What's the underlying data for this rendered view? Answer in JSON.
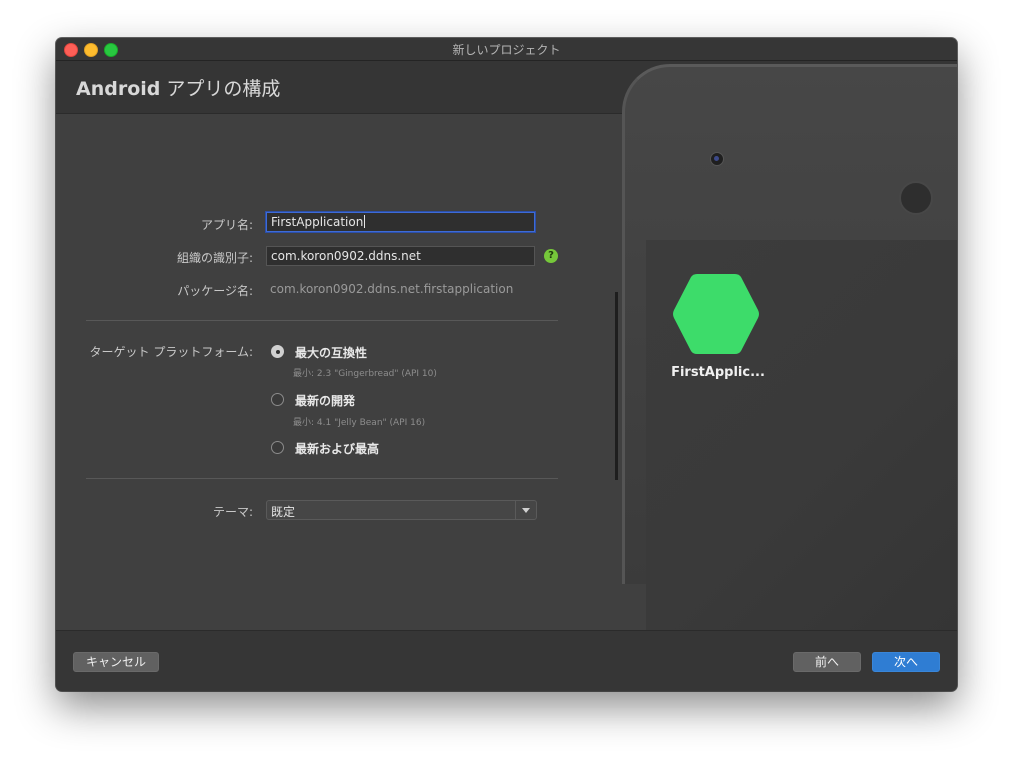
{
  "window": {
    "title": "新しいプロジェクト"
  },
  "header": {
    "title_bold": "Android",
    "title_rest": " アプリの構成"
  },
  "form": {
    "app_name_label": "アプリ名:",
    "app_name_value": "FirstApplication",
    "org_id_label": "組織の識別子:",
    "org_id_value": "com.koron0902.ddns.net",
    "help_icon": "question-icon",
    "help_glyph": "?",
    "package_label": "パッケージ名:",
    "package_value": "com.koron0902.ddns.net.firstapplication",
    "target_label": "ターゲット プラットフォーム:",
    "options": [
      {
        "label": "最大の互換性",
        "sub": "最小: 2.3 \"Gingerbread\" (API 10)",
        "selected": true
      },
      {
        "label": "最新の開発",
        "sub": "最小: 4.1 \"Jelly Bean\" (API 16)",
        "selected": false
      },
      {
        "label": "最新および最高",
        "sub": "",
        "selected": false
      }
    ],
    "theme_label": "テーマ:",
    "theme_value": "既定"
  },
  "preview": {
    "app_label": "FirstApplic...",
    "icon_color": "#3ddc6a"
  },
  "footer": {
    "cancel_label": "キャンセル",
    "back_label": "前へ",
    "next_label": "次へ"
  },
  "colors": {
    "accent": "#2f7dd3",
    "background": "#404040"
  }
}
